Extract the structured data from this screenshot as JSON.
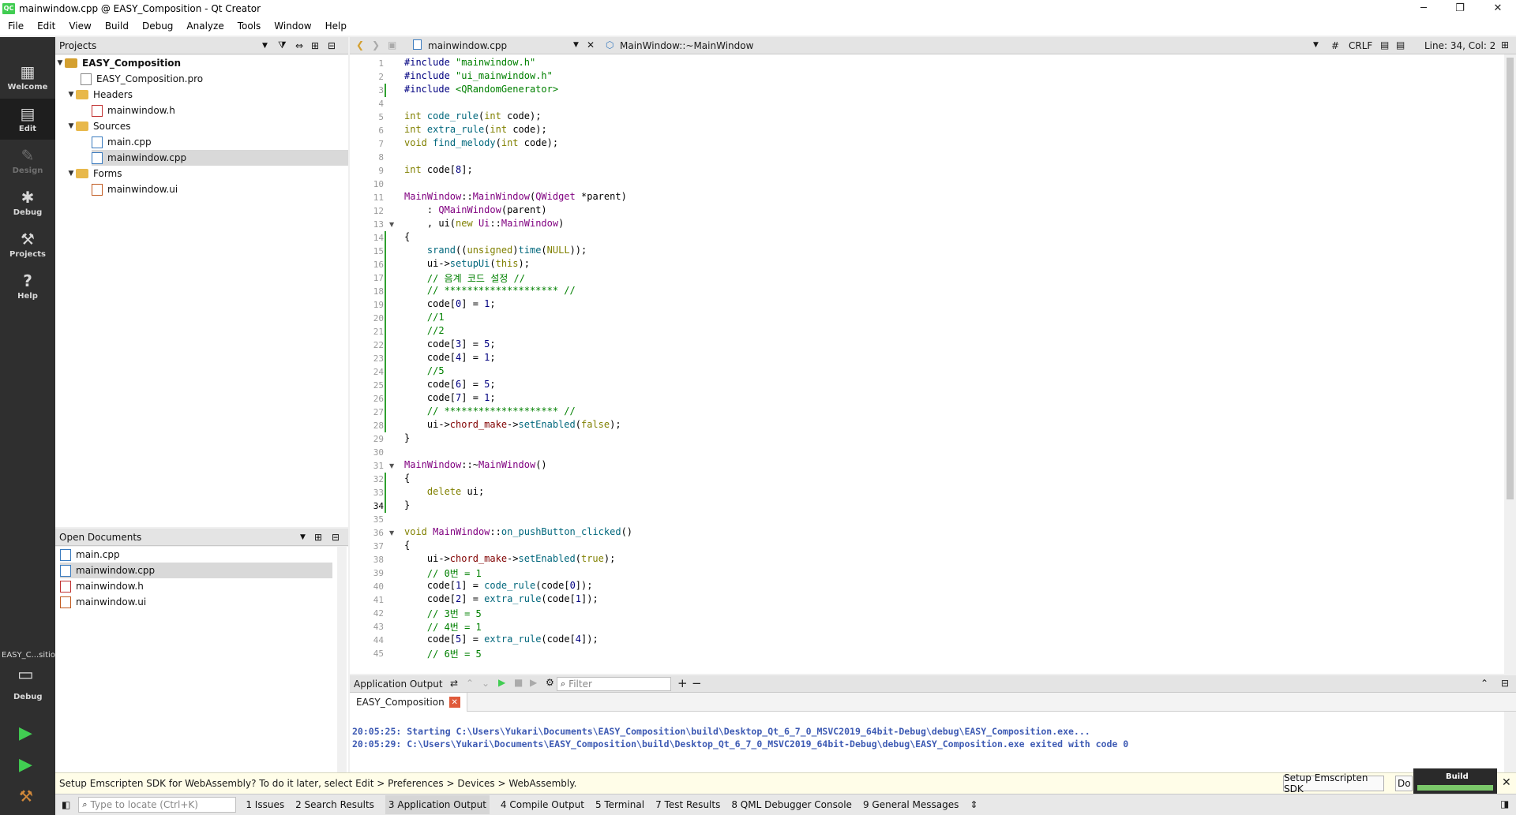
{
  "window": {
    "logo": "QC",
    "title": "mainwindow.cpp @ EASY_Composition - Qt Creator",
    "minimize": "─",
    "maximize": "❐",
    "close": "✕"
  },
  "menu": [
    "File",
    "Edit",
    "View",
    "Build",
    "Debug",
    "Analyze",
    "Tools",
    "Window",
    "Help"
  ],
  "modes": [
    {
      "label": "Welcome",
      "icon": "grid-icon"
    },
    {
      "label": "Edit",
      "icon": "document-icon"
    },
    {
      "label": "Design",
      "icon": "pencil-icon"
    },
    {
      "label": "Debug",
      "icon": "bug-icon"
    },
    {
      "label": "Projects",
      "icon": "wrench-icon"
    },
    {
      "label": "Help",
      "icon": "help-icon"
    }
  ],
  "kit": {
    "name": "EASY_C...sition",
    "mode": "Debug"
  },
  "projects": {
    "header": "Projects",
    "root": "EASY_Composition",
    "pro_file": "EASY_Composition.pro",
    "headers_label": "Headers",
    "header_file": "mainwindow.h",
    "sources_label": "Sources",
    "source_main": "main.cpp",
    "source_mainwindow": "mainwindow.cpp",
    "forms_label": "Forms",
    "form_file": "mainwindow.ui"
  },
  "open_documents": {
    "header": "Open Documents",
    "files": [
      "main.cpp",
      "mainwindow.cpp",
      "mainwindow.h",
      "mainwindow.ui"
    ]
  },
  "editor_toolbar": {
    "file": "mainwindow.cpp",
    "symbol": "MainWindow::~MainWindow",
    "hash": "#",
    "line_ending": "CRLF",
    "position": "Line: 34, Col: 2"
  },
  "code_lines": [
    "#include \"mainwindow.h\"",
    "#include \"ui_mainwindow.h\"",
    "#include <QRandomGenerator>",
    "",
    "int code_rule(int code);",
    "int extra_rule(int code);",
    "void find_melody(int code);",
    "",
    "int code[8];",
    "",
    "MainWindow::MainWindow(QWidget *parent)",
    "    : QMainWindow(parent)",
    "    , ui(new Ui::MainWindow)",
    "{",
    "    srand((unsigned)time(NULL));",
    "    ui->setupUi(this);",
    "    // 음계 코드 설정 //",
    "    // ******************** //",
    "    code[0] = 1;",
    "    //1",
    "    //2",
    "    code[3] = 5;",
    "    code[4] = 1;",
    "    //5",
    "    code[6] = 5;",
    "    code[7] = 1;",
    "    // ******************** //",
    "    ui->chord_make->setEnabled(false);",
    "}",
    "",
    "MainWindow::~MainWindow()",
    "{",
    "    delete ui;",
    "}",
    "",
    "void MainWindow::on_pushButton_clicked()",
    "{",
    "    ui->chord_make->setEnabled(true);",
    "    // 0번 = 1",
    "    code[1] = code_rule(code[0]);",
    "    code[2] = extra_rule(code[1]);",
    "    // 3번 = 5",
    "    // 4번 = 1",
    "    code[5] = extra_rule(code[4]);",
    "    // 6번 = 5"
  ],
  "output": {
    "header": "Application Output",
    "filter_placeholder": "Filter",
    "tab": "EASY_Composition",
    "lines": [
      "20:05:25: Starting C:\\Users\\Yukari\\Documents\\EASY_Composition\\build\\Desktop_Qt_6_7_0_MSVC2019_64bit-Debug\\debug\\EASY_Composition.exe...",
      "20:05:29: C:\\Users\\Yukari\\Documents\\EASY_Composition\\build\\Desktop_Qt_6_7_0_MSVC2019_64bit-Debug\\debug\\EASY_Composition.exe exited with code 0"
    ]
  },
  "infobar": {
    "message": "Setup Emscripten SDK for WebAssembly? To do it later, select Edit > Preferences > Devices > WebAssembly.",
    "setup_button": "Setup Emscripten SDK",
    "do_button": "Do",
    "build_label": "Build"
  },
  "statusbar": {
    "locate_placeholder": "Type to locate (Ctrl+K)",
    "panes": [
      "1  Issues",
      "2  Search Results",
      "3  Application Output",
      "4  Compile Output",
      "5  Terminal",
      "7  Test Results",
      "8  QML Debugger Console",
      "9  General Messages"
    ]
  },
  "colors": {
    "accent_green": "#41cd52",
    "modebar": "#2f2f2f",
    "output_text": "#3d5ab3"
  }
}
